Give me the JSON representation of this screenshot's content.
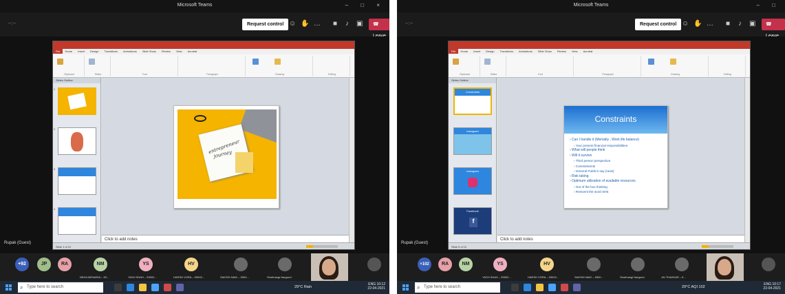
{
  "window": {
    "title": "Microsoft Teams",
    "controls": [
      "–",
      "□",
      "×"
    ]
  },
  "teams": {
    "meeting_time": "--:--",
    "request_control": "Request control",
    "more": "…",
    "leave": "Leave"
  },
  "powerpoint": {
    "tabs": [
      "File",
      "Home",
      "Insert",
      "Design",
      "Transitions",
      "Animations",
      "Slide Show",
      "Review",
      "View",
      "Acrobat"
    ],
    "ribbon_groups": [
      "Clipboard",
      "Slides",
      "Font",
      "Paragraph",
      "Drawing",
      "Editing"
    ],
    "panel_tabs": "Slides   Outline",
    "notes_placeholder": "Click to add notes",
    "status_left": "Slide 1 of 12",
    "status_right": "Slide 5 of 12"
  },
  "left": {
    "slide_cover_text": [
      "entrepreneur",
      "journey"
    ],
    "thumb_numbers": [
      "1",
      "2",
      "3",
      "4"
    ]
  },
  "right": {
    "slide_title": "Constraints",
    "bullets": [
      "Can I handle it (Mentally , Work life balance)",
      "Your present financial responsibilities",
      "What will people think",
      "Will it survive",
      "Third person perspective",
      "Commitments",
      "General Public's say (ness)",
      "Risk taking",
      "Optimum utilization of available resources",
      "Out of the box thinking",
      "Reinvent the word SHE"
    ],
    "bullet_levels": [
      1,
      2,
      1,
      1,
      2,
      2,
      2,
      1,
      1,
      2,
      2
    ],
    "thumb_labels": [
      "Constraints",
      "Instagram",
      "Instagram",
      "Facebook"
    ]
  },
  "guest": "Rupak (Guest)",
  "participants_left": [
    {
      "initials": "+92",
      "color": "#3a5fb8"
    },
    {
      "initials": "JP",
      "color": "#9fbe8a"
    },
    {
      "initials": "RA",
      "color": "#e6a0a7"
    },
    {
      "initials": "NM",
      "color": "#b7d3a5",
      "name": "NEHA MENARIA – 53..."
    },
    {
      "initials": "YS",
      "color": "#f0b0c0",
      "name": "YASH SHAH – 53002..."
    },
    {
      "initials": "HV",
      "color": "#f5d58a",
      "name": "HARSH VORA – 53002..."
    },
    {
      "initials": "",
      "color": "#6a6a6a",
      "name": "SAKSHI NAIK – 5300..."
    },
    {
      "initials": "",
      "color": "#6a6a6a",
      "name": "Shubhangi Nargund"
    }
  ],
  "participants_right": [
    {
      "initials": "+102",
      "color": "#3a5fb8"
    },
    {
      "initials": "RA",
      "color": "#e6a0a7"
    },
    {
      "initials": "NM",
      "color": "#b7d3a5"
    },
    {
      "initials": "YS",
      "color": "#f0b0c0",
      "name": "YASH SHAH – 53002..."
    },
    {
      "initials": "HV",
      "color": "#f5d58a",
      "name": "HARSH VORA – 53002..."
    },
    {
      "initials": "",
      "color": "#6a6a6a",
      "name": "SAKSHI NAIK – 5300..."
    },
    {
      "initials": "",
      "color": "#6a6a6a",
      "name": "Shubhangi Nargund"
    },
    {
      "initials": "",
      "color": "#6a6a6a",
      "name": "JAI THAKKAR – 5..."
    }
  ],
  "taskbar": {
    "search_placeholder": "Type here to search",
    "weather_left": "29°C Rain",
    "weather_right": "29°C AQI 102",
    "lang": "ENG",
    "time_left": "10:12",
    "time_right": "10:17",
    "date": "22-04-2021"
  },
  "colors": {
    "teams_dark": "#1f1f1f",
    "leave_red": "#c4314b",
    "ppt_red": "#c0392b",
    "slide_blue": "#2e86de",
    "cover_yellow": "#f5b400"
  }
}
